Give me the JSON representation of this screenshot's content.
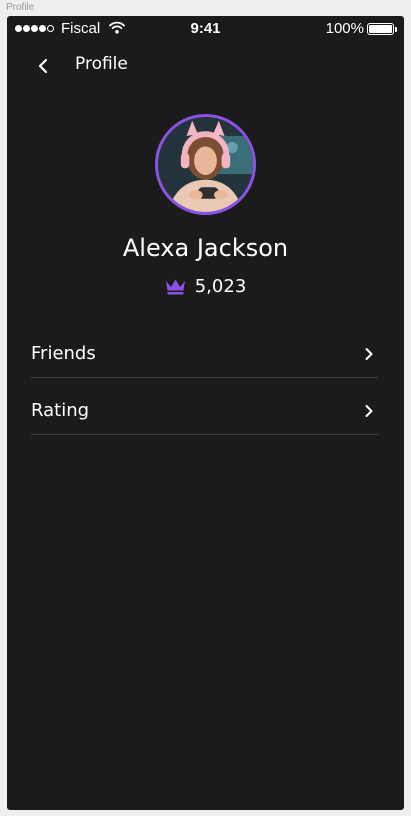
{
  "frame_label": "Profile",
  "status_bar": {
    "carrier": "Fiscal",
    "time": "9:41",
    "battery": "100%"
  },
  "nav": {
    "title": "Profile",
    "back_icon": "chevron-left-icon"
  },
  "profile": {
    "name": "Alexa Jackson",
    "score": "5,023",
    "score_icon": "crown-icon",
    "avatar_ring_color": "#8c52e6"
  },
  "menu": {
    "items": [
      {
        "label": "Friends",
        "icon": "chevron-right-icon"
      },
      {
        "label": "Rating",
        "icon": "chevron-right-icon"
      }
    ]
  },
  "colors": {
    "background": "#1b1b1b",
    "accent": "#8c52e6",
    "divider": "#3e3e3e",
    "text": "#ffffff"
  }
}
